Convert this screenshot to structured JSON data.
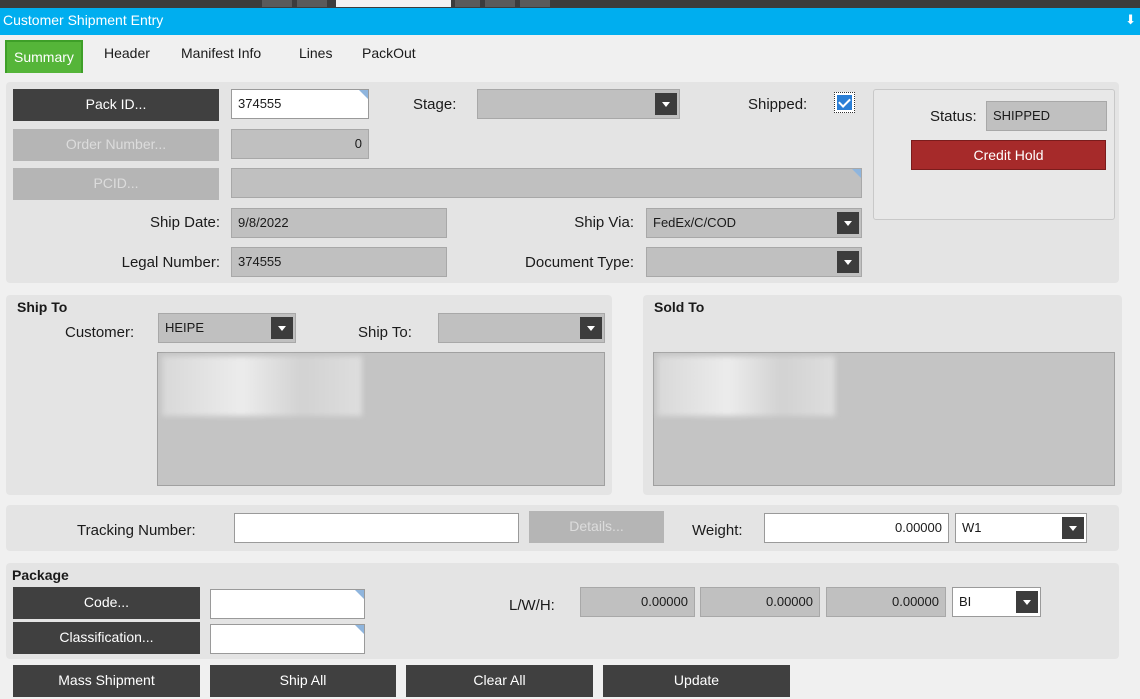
{
  "window": {
    "title": "Customer Shipment Entry",
    "pin_glyph": " "
  },
  "tabs": [
    "Summary",
    "Header",
    "Manifest Info",
    "Lines",
    "PackOut"
  ],
  "main": {
    "pack_id_button": "Pack ID...",
    "pack_id_value": "374555",
    "order_number_button": "Order Number...",
    "order_number_value": "0",
    "pcid_button": "PCID...",
    "pcid_value": "",
    "stage_label": "Stage:",
    "stage_value": "",
    "shipped_label": "Shipped:",
    "shipped_checked": true,
    "ship_date_label": "Ship Date:",
    "ship_date_value": "9/8/2022",
    "legal_number_label": "Legal Number:",
    "legal_number_value": "374555",
    "ship_via_label": "Ship Via:",
    "ship_via_value": "FedEx/C/COD",
    "document_type_label": "Document Type:",
    "document_type_value": ""
  },
  "status": {
    "label": "Status:",
    "value": "SHIPPED",
    "credit_hold": "Credit Hold",
    "credit_color": "#a62a2a"
  },
  "ship_to": {
    "title": "Ship To",
    "customer_label": "Customer:",
    "customer_value": "HEIPE",
    "ship_to_label": "Ship To:",
    "ship_to_value": ""
  },
  "sold_to": {
    "title": "Sold To"
  },
  "tracking": {
    "tracking_label": "Tracking Number:",
    "tracking_value": "",
    "details_button": "Details...",
    "weight_label": "Weight:",
    "weight_value": "0.00000",
    "weight_unit": "W1"
  },
  "package": {
    "title": "Package",
    "code_button": "Code...",
    "code_value": "",
    "classification_button": "Classification...",
    "classification_value": "",
    "lwh_label": "L/W/H:",
    "length": "0.00000",
    "width": "0.00000",
    "height": "0.00000",
    "dim_unit": "BI"
  },
  "actions": {
    "mass_shipment": "Mass Shipment",
    "ship_all": "Ship All",
    "clear_all": "Clear All",
    "update": "Update"
  },
  "colors": {
    "accent": "#00aeef",
    "tab_active": "#55b539",
    "button_dark": "#404040"
  }
}
